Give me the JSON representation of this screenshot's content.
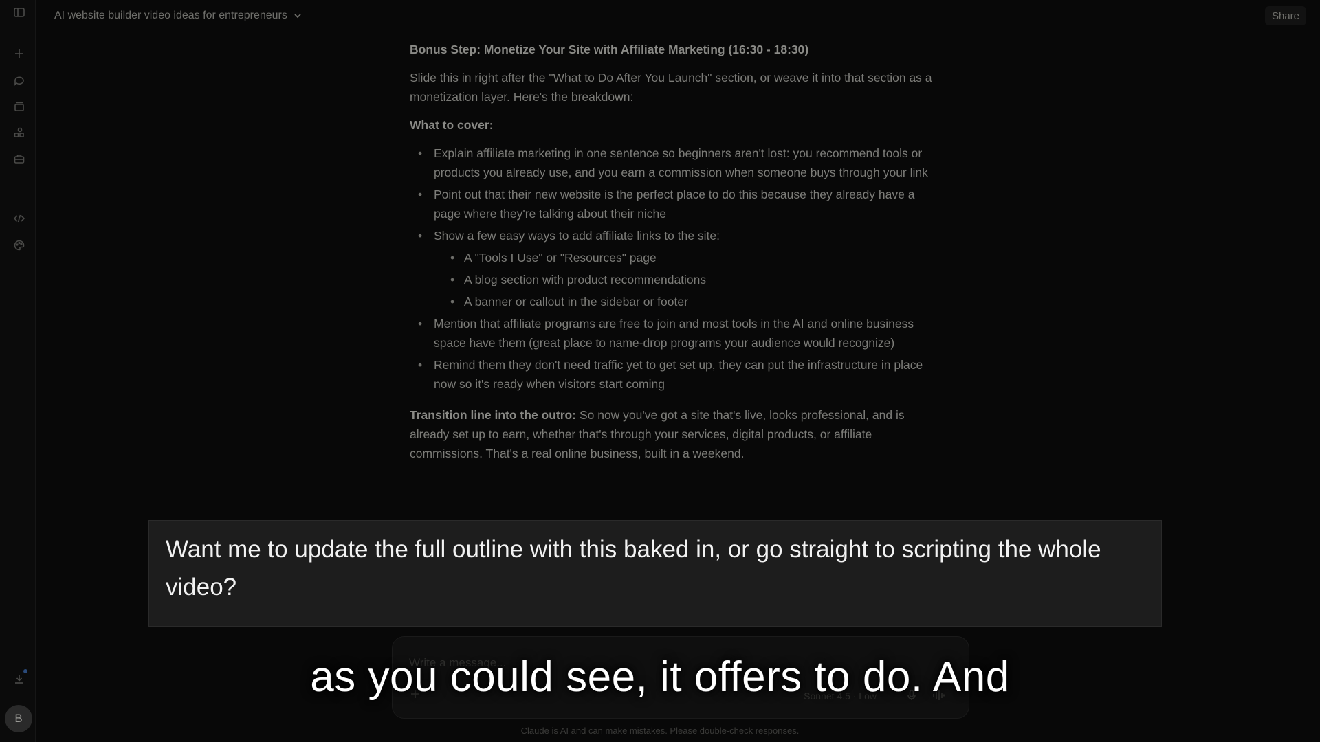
{
  "header": {
    "conversation_title": "AI website builder video ideas for entrepreneurs",
    "share_label": "Share"
  },
  "sidebar": {
    "icons": [
      "sidebar-toggle-icon",
      "new-chat-icon",
      "chats-icon",
      "projects-icon",
      "artifacts-icon",
      "tools-icon",
      "code-icon",
      "palette-icon",
      "download-icon"
    ],
    "avatar_initial": "B"
  },
  "message": {
    "heading": "Bonus Step: Monetize Your Site with Affiliate Marketing (16:30 - 18:30)",
    "intro": "Slide this in right after the \"What to Do After You Launch\" section, or weave it into that section as a monetization layer. Here's the breakdown:",
    "what_to_cover_label": "What to cover:",
    "bullets": [
      "Explain affiliate marketing in one sentence so beginners aren't lost: you recommend tools or products you already use, and you earn a commission when someone buys through your link",
      "Point out that their new website is the perfect place to do this because they already have a page where they're talking about their niche",
      "Show a few easy ways to add affiliate links to the site:",
      "Mention that affiliate programs are free to join and most tools in the AI and online business space have them (great place to name-drop programs your audience would recognize)",
      "Remind them they don't need traffic yet to get set up, they can put the infrastructure in place now so it's ready when visitors start coming"
    ],
    "sub_bullets": [
      "A \"Tools I Use\" or \"Resources\" page",
      "A blog section with product recommendations",
      "A banner or callout in the sidebar or footer"
    ],
    "transition_label": "Transition line into the outro:",
    "transition_text": " So now you've got a site that's live, looks professional, and is already set up to earn, whether that's through your services, digital products, or affiliate commissions. That's a real online business, built in a weekend."
  },
  "highlight": {
    "text": "Want me to update the full outline with this baked in, or go straight to scripting the whole video?"
  },
  "composer": {
    "placeholder": "Write a message...",
    "model_label": "Sonnet 4.5 · Low"
  },
  "disclaimer": "Claude is AI and can make mistakes. Please double-check responses.",
  "caption": "as you could see, it offers to do. And"
}
